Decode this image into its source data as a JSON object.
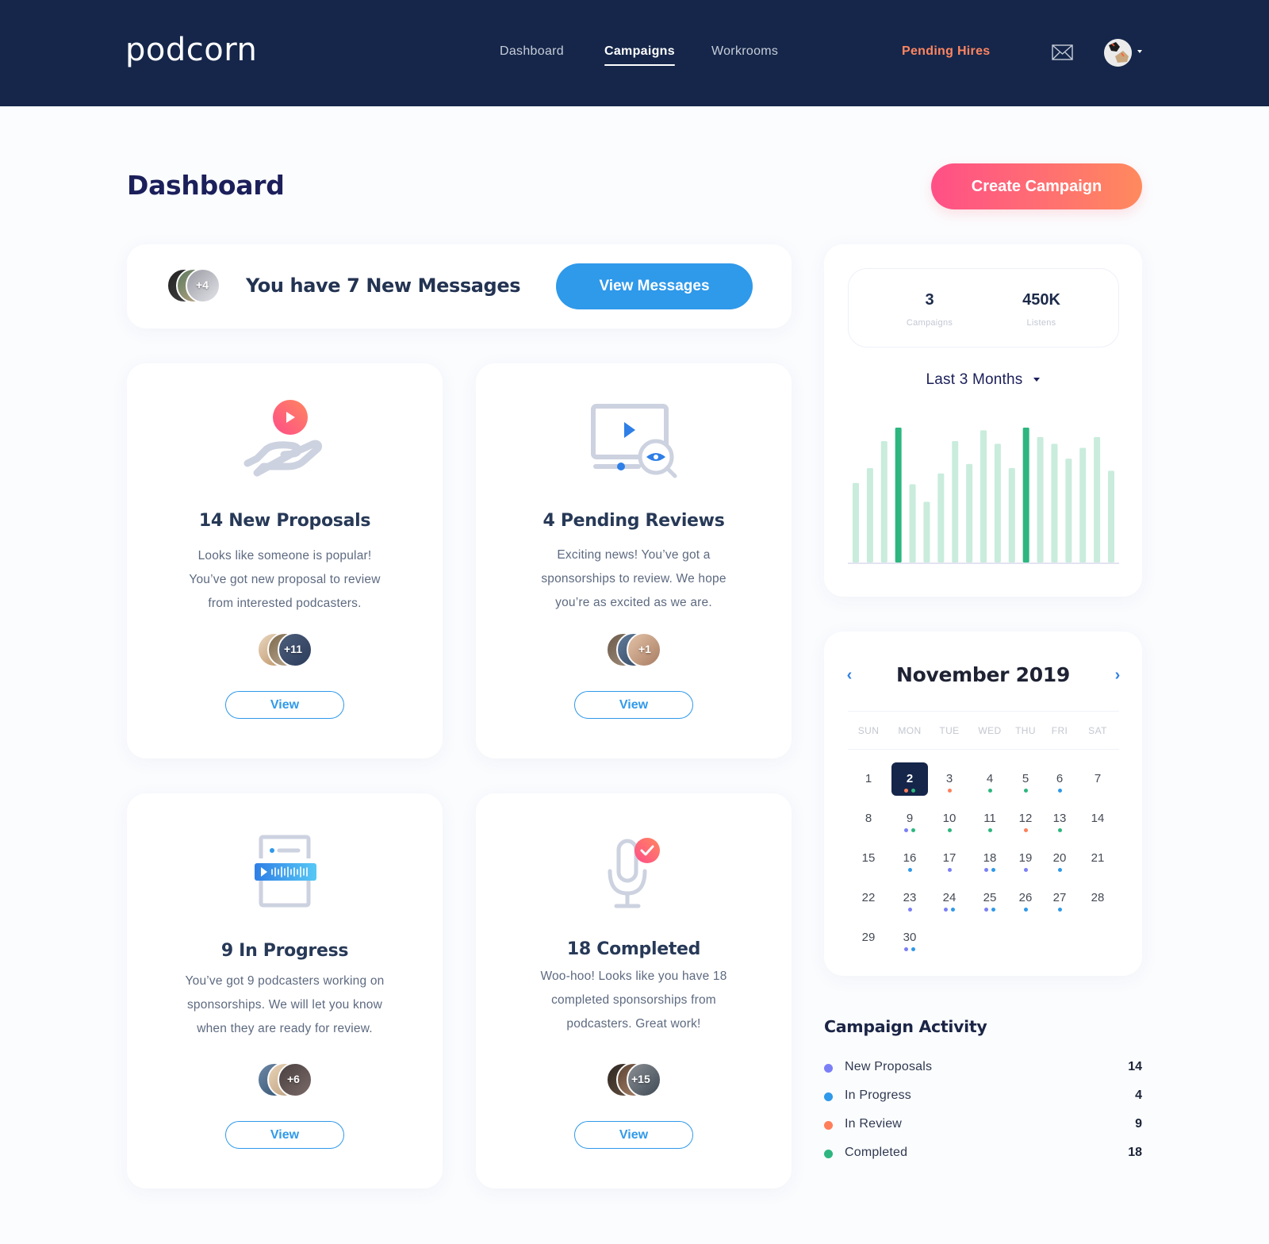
{
  "header": {
    "logo": "podcorn",
    "nav": [
      {
        "label": "Dashboard",
        "active": false
      },
      {
        "label": "Campaigns",
        "active": true
      },
      {
        "label": "Workrooms",
        "active": false
      }
    ],
    "pending_hires": "Pending Hires",
    "icons": {
      "mail": "mail-icon",
      "avatar": "user-avatar",
      "dropdown": "caret-down-icon"
    }
  },
  "page": {
    "title": "Dashboard",
    "create_button": "Create Campaign"
  },
  "messages": {
    "text": "You have 7 New Messages",
    "avatar_overflow": "+4",
    "button": "View Messages"
  },
  "cards": [
    {
      "icon": "hand-play-icon",
      "title": "14 New Proposals",
      "desc": [
        "Looks like someone is popular!",
        "You’ve got new proposal to review",
        "from interested podcasters."
      ],
      "avatar_overflow": "+11",
      "button": "View"
    },
    {
      "icon": "video-review-icon",
      "title": "4 Pending Reviews",
      "desc": [
        "Exciting news! You’ve got a",
        "sponsorships to review. We hope",
        "you’re as excited as we are."
      ],
      "avatar_overflow": "+1",
      "button": "View"
    },
    {
      "icon": "audio-document-icon",
      "title": "9 In Progress",
      "desc": [
        "You’ve got 9 podcasters working on",
        "sponsorships. We will let you know",
        "when they are ready for review."
      ],
      "avatar_overflow": "+6",
      "button": "View"
    },
    {
      "icon": "microphone-check-icon",
      "title": "18 Completed",
      "desc": [
        "Woo-hoo! Looks like you have 18",
        "completed sponsorships from",
        "podcasters. Great work!"
      ],
      "avatar_overflow": "+15",
      "button": "View"
    }
  ],
  "summary": {
    "campaigns_value": "3",
    "campaigns_label": "Campaigns",
    "listens_value": "450K",
    "listens_label": "Listens",
    "range": "Last 3 Months"
  },
  "chart_data": {
    "type": "bar",
    "title": "",
    "xlabel": "",
    "ylabel": "",
    "values": [
      59,
      70,
      90,
      100,
      58,
      45,
      66,
      90,
      73,
      98,
      88,
      70,
      100,
      93,
      88,
      77,
      85,
      93,
      68
    ],
    "highlighted": [
      3,
      12
    ],
    "ylim": [
      0,
      100
    ],
    "colors": {
      "normal": "#c9ecdd",
      "highlight": "#2db67f",
      "baseline": "#e3e4f2"
    },
    "grid": false,
    "legend": "none"
  },
  "calendar": {
    "title": "November 2019",
    "prev": "‹",
    "next": "›",
    "weekdays": [
      "SUN",
      "MON",
      "TUE",
      "WED",
      "THU",
      "FRI",
      "SAT"
    ],
    "selected": 2,
    "start_weekday": 0,
    "days": [
      {
        "d": "1",
        "dots": []
      },
      {
        "d": "2",
        "dots": [
          "review",
          "completed"
        ]
      },
      {
        "d": "3",
        "dots": [
          "review"
        ]
      },
      {
        "d": "4",
        "dots": [
          "completed"
        ]
      },
      {
        "d": "5",
        "dots": [
          "completed"
        ]
      },
      {
        "d": "6",
        "dots": [
          "progress"
        ]
      },
      {
        "d": "7",
        "dots": []
      },
      {
        "d": "8",
        "dots": []
      },
      {
        "d": "9",
        "dots": [
          "proposal",
          "completed"
        ]
      },
      {
        "d": "10",
        "dots": [
          "completed"
        ]
      },
      {
        "d": "11",
        "dots": [
          "completed"
        ]
      },
      {
        "d": "12",
        "dots": [
          "review"
        ]
      },
      {
        "d": "13",
        "dots": [
          "completed"
        ]
      },
      {
        "d": "14",
        "dots": []
      },
      {
        "d": "15",
        "dots": []
      },
      {
        "d": "16",
        "dots": [
          "progress"
        ]
      },
      {
        "d": "17",
        "dots": [
          "proposal"
        ]
      },
      {
        "d": "18",
        "dots": [
          "proposal",
          "progress"
        ]
      },
      {
        "d": "19",
        "dots": [
          "proposal"
        ]
      },
      {
        "d": "20",
        "dots": [
          "progress"
        ]
      },
      {
        "d": "21",
        "dots": []
      },
      {
        "d": "22",
        "dots": []
      },
      {
        "d": "23",
        "dots": [
          "proposal"
        ]
      },
      {
        "d": "24",
        "dots": [
          "proposal",
          "progress"
        ]
      },
      {
        "d": "25",
        "dots": [
          "proposal",
          "progress"
        ]
      },
      {
        "d": "26",
        "dots": [
          "progress"
        ]
      },
      {
        "d": "27",
        "dots": [
          "progress"
        ]
      },
      {
        "d": "28",
        "dots": []
      },
      {
        "d": "29",
        "dots": []
      },
      {
        "d": "30",
        "dots": [
          "proposal",
          "progress"
        ]
      }
    ]
  },
  "status_colors": {
    "proposal": "#7b7ff6",
    "progress": "#2f99ea",
    "review": "#ff7f5a",
    "completed": "#2db67f"
  },
  "activity": {
    "title": "Campaign Activity",
    "items": [
      {
        "label": "New Proposals",
        "count": "14",
        "status": "proposal"
      },
      {
        "label": "In Progress",
        "count": "4",
        "status": "progress"
      },
      {
        "label": "In Review",
        "count": "9",
        "status": "review"
      },
      {
        "label": "Completed",
        "count": "18",
        "status": "completed"
      }
    ]
  }
}
